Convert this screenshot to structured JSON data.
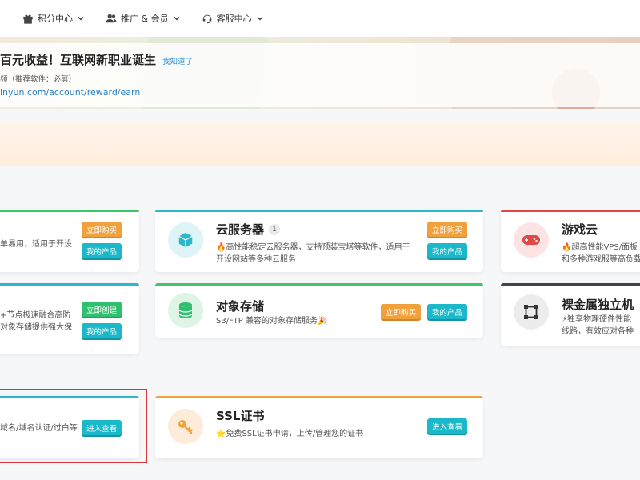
{
  "nav": {
    "items": [
      {
        "label": "积分中心",
        "icon": "gift-icon"
      },
      {
        "label": "推广 & 会员",
        "icon": "users-icon"
      },
      {
        "label": "客服中心",
        "icon": "headset-icon"
      }
    ]
  },
  "banner": {
    "title": "百元收益！互联网新职业诞生",
    "dismiss": "我知道了",
    "subtitle": "频（推荐软件：必剪）",
    "link": "inyun.com/account/reward/earn"
  },
  "cards": {
    "c1": {
      "desc_lines": [
        "单易用，适用于开设"
      ],
      "btn1": "立即购买",
      "btn2": "我的产品",
      "accent": "#3cc86a"
    },
    "cloud_server": {
      "title": "云服务器",
      "badge": "1",
      "desc_lines": [
        "🔥高性能稳定云服务器，支持预装宝塔等软件，适用于",
        "开设网站等多种云服务"
      ],
      "btn1": "立即购买",
      "btn2": "我的产品",
      "accent": "#2bb8cc"
    },
    "game_cloud": {
      "title": "游戏云",
      "desc_lines": [
        "🔥超高性能VPS/面板",
        "和多种游戏服等高负载"
      ],
      "accent": "#e04848"
    },
    "c4": {
      "desc_lines": [
        "+节点极速融合高防",
        "对象存储提供强大保"
      ],
      "btn1": "立即创建",
      "btn2": "我的产品",
      "accent": "#2bb8cc"
    },
    "object_storage": {
      "title": "对象存储",
      "desc_lines": [
        "S3/FTP 兼容的对象存储服务🎉"
      ],
      "btn1": "立即购买",
      "btn2": "我的产品",
      "accent": "#3cc86a"
    },
    "bare_metal": {
      "title": "裸金属独立机",
      "desc_lines": [
        "⚡独享物理硬件性能",
        "线路，有效应对各种"
      ],
      "accent": "#444444"
    },
    "c7": {
      "desc_lines": [
        "域名/域名认证/过白等"
      ],
      "btn1": "进入查看",
      "accent": "#2bb8cc"
    },
    "ssl": {
      "title": "SSL证书",
      "desc_lines": [
        "⭐免费SSL证书申请，上传/管理您的证书"
      ],
      "btn1": "进入查看",
      "accent": "#f0a13c"
    }
  }
}
